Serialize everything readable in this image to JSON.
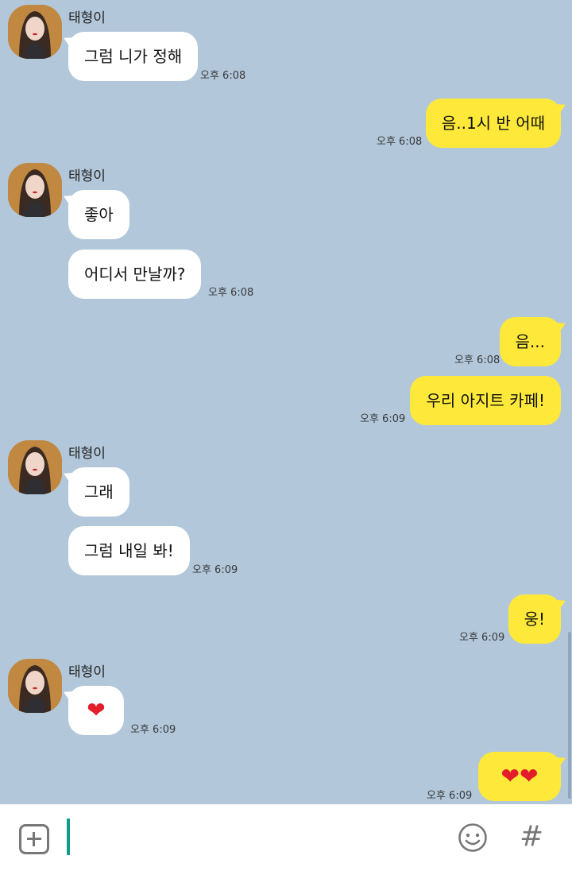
{
  "colors": {
    "background": "#b2c7da",
    "incoming_bubble": "#ffffff",
    "outgoing_bubble": "#fee93b",
    "caret": "#129b8c"
  },
  "contact": {
    "name": "태형이",
    "avatar": "profile-photo"
  },
  "messages": {
    "m1": {
      "text": "그럼 니가 정해",
      "time": "오후 6:08"
    },
    "m2": {
      "text": "음..1시 반 어때",
      "time": "오후 6:08"
    },
    "m3": {
      "text": "좋아"
    },
    "m4": {
      "text": "어디서 만날까?",
      "time": "오후 6:08"
    },
    "m5": {
      "text": "음...",
      "time": "오후 6:08"
    },
    "m6": {
      "text": "우리 아지트 카페!",
      "time": "오후 6:09"
    },
    "m7": {
      "text": "그래"
    },
    "m8": {
      "text": "그럼 내일 봐!",
      "time": "오후 6:09"
    },
    "m9": {
      "text": "웅!",
      "time": "오후 6:09"
    },
    "m10": {
      "emoji": "❤",
      "time": "오후 6:09"
    },
    "m11": {
      "emoji": "❤❤",
      "time": "오후 6:09"
    }
  },
  "input_bar": {
    "plus_icon": "plus-square-icon",
    "emoji_icon": "smiley-icon",
    "hash_label": "#",
    "value": ""
  }
}
